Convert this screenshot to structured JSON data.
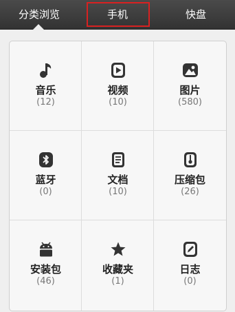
{
  "tabs": [
    {
      "label": "分类浏览"
    },
    {
      "label": "手机"
    },
    {
      "label": "快盘"
    }
  ],
  "categories": [
    {
      "label": "音乐",
      "count": "(12)",
      "icon": "music-note-icon"
    },
    {
      "label": "视频",
      "count": "(10)",
      "icon": "video-play-icon"
    },
    {
      "label": "图片",
      "count": "(580)",
      "icon": "image-icon"
    },
    {
      "label": "蓝牙",
      "count": "(0)",
      "icon": "bluetooth-icon"
    },
    {
      "label": "文档",
      "count": "(10)",
      "icon": "document-icon"
    },
    {
      "label": "压缩包",
      "count": "(26)",
      "icon": "zip-archive-icon"
    },
    {
      "label": "安装包",
      "count": "(46)",
      "icon": "android-package-icon"
    },
    {
      "label": "收藏夹",
      "count": "(1)",
      "icon": "star-icon"
    },
    {
      "label": "日志",
      "count": "(0)",
      "icon": "log-edit-icon"
    }
  ],
  "colors": {
    "topbar": "#3a3a3a",
    "highlight_frame": "#d92121",
    "icon": "#333333"
  }
}
